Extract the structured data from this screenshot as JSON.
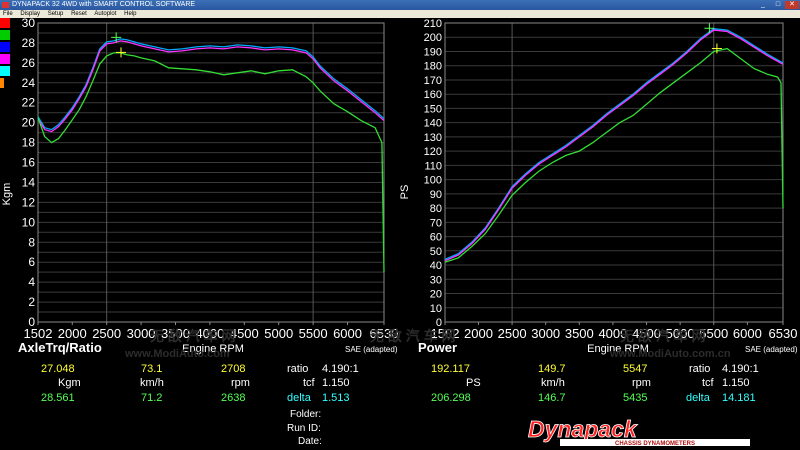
{
  "window": {
    "title": "DYNAPACK 32 4WD with SMART CONTROL SOFTWARE",
    "controls": [
      "_",
      "□",
      "✕"
    ]
  },
  "menu": [
    "File",
    "Display",
    "Setup",
    "Reset",
    "Autoplot",
    "Help"
  ],
  "swatch_colors": [
    "#ff0000",
    "#00cc00",
    "#0000ff",
    "#ff00ff",
    "#00ffff",
    "#ff8800"
  ],
  "watermarks": {
    "brand": "MODIAUTO",
    "brand_text": "无 敌 汽 车 网",
    "url_left": "www.ModiAuto.com",
    "url_right": "www.ModiAuto.com.cn"
  },
  "chart_data": [
    {
      "type": "line",
      "title": "AxleTrq/Ratio",
      "xlabel": "Engine RPM",
      "ylabel": "Kgm",
      "note": "SAE (adapted)",
      "xlim": [
        1502,
        6530
      ],
      "ylim": [
        0,
        30
      ],
      "x_ticks": [
        "1502",
        "2000",
        "2500",
        "3000",
        "3500",
        "4000",
        "4500",
        "5000",
        "5500",
        "6000",
        "6530"
      ],
      "y_ticks": [
        "0",
        "1",
        "2",
        "3",
        "4",
        "5",
        "6",
        "7",
        "8",
        "9",
        "10",
        "11",
        "12",
        "13",
        "14",
        "15",
        "16",
        "17",
        "18",
        "19",
        "20",
        "21",
        "22",
        "23",
        "24",
        "25",
        "26",
        "27",
        "28",
        "29",
        "30"
      ],
      "y_ticks_labeled": [
        "0",
        "2",
        "4",
        "6",
        "8",
        "10",
        "12",
        "14",
        "16",
        "18",
        "20",
        "22",
        "24",
        "26",
        "28",
        "30"
      ],
      "x_grid": [
        2500,
        5500
      ],
      "grid": true,
      "cursor_marks": [
        {
          "x": 2708,
          "y": 27.05,
          "color": "#ffff33"
        },
        {
          "x": 2638,
          "y": 28.56,
          "color": "#55ff55"
        }
      ],
      "series": [
        {
          "color": "#00aaff",
          "x": [
            1502,
            1600,
            1700,
            1800,
            1900,
            2000,
            2100,
            2200,
            2300,
            2400,
            2500,
            2600,
            2700,
            2800,
            2900,
            3000,
            3200,
            3400,
            3600,
            3800,
            4000,
            4200,
            4400,
            4600,
            4800,
            5000,
            5200,
            5400,
            5500,
            5600,
            5800,
            6000,
            6200,
            6400,
            6530
          ],
          "y": [
            20.6,
            19.5,
            19.3,
            19.8,
            20.6,
            21.5,
            22.6,
            23.8,
            25.5,
            27.4,
            28.1,
            28.2,
            28.4,
            28.3,
            28.1,
            27.9,
            27.6,
            27.3,
            27.4,
            27.6,
            27.7,
            27.6,
            27.8,
            27.7,
            27.5,
            27.6,
            27.5,
            27.2,
            26.6,
            25.7,
            24.4,
            23.4,
            22.3,
            21.2,
            20.4
          ]
        },
        {
          "color": "#ff33ff",
          "x": [
            1502,
            1600,
            1700,
            1800,
            1900,
            2000,
            2100,
            2200,
            2300,
            2400,
            2500,
            2600,
            2700,
            2800,
            2900,
            3000,
            3200,
            3400,
            3600,
            3800,
            4000,
            4200,
            4400,
            4600,
            4800,
            5000,
            5200,
            5400,
            5500,
            5600,
            5800,
            6000,
            6200,
            6400,
            6530
          ],
          "y": [
            20.4,
            19.3,
            19.1,
            19.6,
            20.4,
            21.3,
            22.4,
            23.6,
            25.3,
            27.2,
            27.9,
            28.0,
            28.2,
            28.1,
            27.9,
            27.7,
            27.4,
            27.1,
            27.2,
            27.4,
            27.5,
            27.4,
            27.6,
            27.5,
            27.3,
            27.4,
            27.3,
            27.0,
            26.4,
            25.5,
            24.2,
            23.2,
            22.1,
            21.0,
            20.2
          ]
        },
        {
          "color": "#33dd33",
          "x": [
            1502,
            1600,
            1700,
            1800,
            1900,
            2000,
            2100,
            2200,
            2300,
            2400,
            2500,
            2600,
            2700,
            2800,
            2900,
            3000,
            3200,
            3400,
            3600,
            3800,
            4000,
            4200,
            4400,
            4600,
            4800,
            5000,
            5200,
            5400,
            5500,
            5600,
            5800,
            6000,
            6200,
            6400,
            6500,
            6530
          ],
          "y": [
            20.5,
            18.6,
            18.0,
            18.4,
            19.3,
            20.3,
            21.3,
            22.6,
            24.2,
            25.9,
            26.7,
            27.0,
            27.0,
            26.8,
            26.7,
            26.5,
            26.2,
            25.5,
            25.4,
            25.3,
            25.1,
            24.8,
            25.0,
            25.2,
            24.9,
            25.2,
            25.3,
            24.6,
            24.0,
            23.2,
            21.9,
            21.1,
            20.2,
            19.5,
            18.0,
            5.0
          ]
        }
      ]
    },
    {
      "type": "line",
      "title": "Power",
      "xlabel": "Engine RPM",
      "ylabel": "PS",
      "note": "SAE (adapted)",
      "xlim": [
        1502,
        6530
      ],
      "ylim": [
        0,
        210
      ],
      "x_ticks": [
        "1502",
        "2000",
        "2500",
        "3000",
        "3500",
        "4000",
        "4500",
        "5000",
        "5500",
        "6000",
        "6530"
      ],
      "y_ticks": [
        "0",
        "10",
        "20",
        "30",
        "40",
        "50",
        "60",
        "70",
        "80",
        "90",
        "100",
        "110",
        "120",
        "130",
        "140",
        "150",
        "160",
        "170",
        "180",
        "190",
        "200",
        "210"
      ],
      "x_grid": [
        2500,
        5500
      ],
      "grid": true,
      "cursor_marks": [
        {
          "x": 5547,
          "y": 192.1,
          "color": "#ffff33"
        },
        {
          "x": 5435,
          "y": 206.3,
          "color": "#55ff55"
        }
      ],
      "series": [
        {
          "color": "#00aaff",
          "x": [
            1502,
            1700,
            1900,
            2100,
            2300,
            2500,
            2700,
            2900,
            3100,
            3300,
            3500,
            3700,
            3900,
            4100,
            4300,
            4500,
            4700,
            4900,
            5100,
            5300,
            5500,
            5700,
            5900,
            6100,
            6300,
            6530
          ],
          "y": [
            44,
            48,
            56,
            66,
            80,
            95,
            104,
            112,
            118,
            124,
            131,
            138,
            146,
            153,
            160,
            168,
            175,
            182,
            190,
            199,
            206,
            205,
            200,
            194,
            188,
            182
          ]
        },
        {
          "color": "#ff33ff",
          "x": [
            1502,
            1700,
            1900,
            2100,
            2300,
            2500,
            2700,
            2900,
            3100,
            3300,
            3500,
            3700,
            3900,
            4100,
            4300,
            4500,
            4700,
            4900,
            5100,
            5300,
            5500,
            5700,
            5900,
            6100,
            6300,
            6530
          ],
          "y": [
            43,
            47,
            55,
            65,
            79,
            94,
            103,
            111,
            117,
            123,
            130,
            137,
            145,
            152,
            159,
            167,
            174,
            181,
            189,
            198,
            205,
            204,
            199,
            193,
            187,
            181
          ]
        },
        {
          "color": "#33dd33",
          "x": [
            1502,
            1700,
            1900,
            2100,
            2300,
            2500,
            2700,
            2900,
            3100,
            3300,
            3500,
            3700,
            3900,
            4100,
            4300,
            4500,
            4700,
            4900,
            5100,
            5300,
            5500,
            5700,
            5900,
            6100,
            6300,
            6450,
            6500,
            6530
          ],
          "y": [
            42,
            45,
            53,
            62,
            75,
            89,
            98,
            106,
            112,
            117,
            120,
            126,
            133,
            140,
            145,
            153,
            161,
            168,
            175,
            182,
            190,
            192,
            185,
            178,
            174,
            172,
            168,
            80
          ]
        }
      ]
    }
  ],
  "readout": {
    "left": {
      "r1": {
        "val1": "27.048",
        "val2": "73.1",
        "val3": "2708",
        "label": "ratio",
        "value": "4.190:1"
      },
      "r2": {
        "u1": "Kgm",
        "u2": "km/h",
        "u3": "rpm",
        "label": "tcf",
        "value": "1.150"
      },
      "r3": {
        "val1": "28.561",
        "val2": "71.2",
        "val3": "2638",
        "label": "delta",
        "value": "1.513"
      }
    },
    "right": {
      "r1": {
        "val1": "192.117",
        "val2": "149.7",
        "val3": "5547",
        "label": "ratio",
        "value": "4.190:1"
      },
      "r2": {
        "u1": "PS",
        "u2": "km/h",
        "u3": "rpm",
        "label": "tcf",
        "value": "1.150"
      },
      "r3": {
        "val1": "206.298",
        "val2": "146.7",
        "val3": "5435",
        "label": "delta",
        "value": "14.181"
      }
    },
    "folder_label": "Folder:",
    "runid_label": "Run ID:",
    "date_label": "Date:"
  },
  "logo": {
    "brand": "Dynapack",
    "tagline": "CHASSIS DYNAMOMETERS"
  }
}
